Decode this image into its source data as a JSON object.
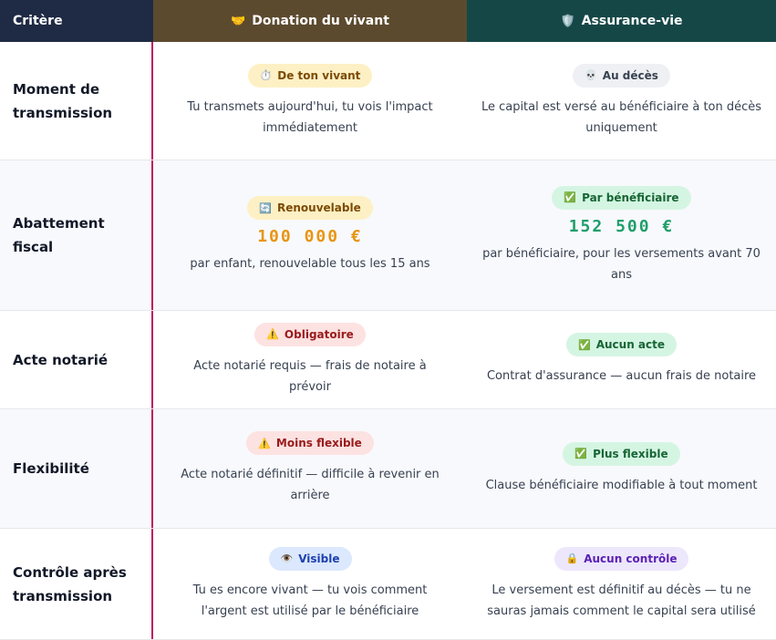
{
  "header": {
    "criteria": "Critère",
    "donation": {
      "icon": "🤝",
      "label": "Donation du vivant"
    },
    "assurance": {
      "icon": "🛡️",
      "label": "Assurance-vie"
    }
  },
  "rows": [
    {
      "criteria": "Moment de transmission",
      "donation": {
        "badge_icon": "⏱️",
        "badge": "De ton vivant",
        "desc": "Tu transmets aujourd'hui, tu vois l'impact immédiatement"
      },
      "assurance": {
        "badge_icon": "💀",
        "badge": "Au décès",
        "desc": "Le capital est versé au bénéficiaire à ton décès uniquement"
      }
    },
    {
      "criteria": "Abattement fiscal",
      "donation": {
        "badge_icon": "🔄",
        "badge": "Renouvelable",
        "amount": "100 000 €",
        "desc": "par enfant, renouvelable tous les 15 ans"
      },
      "assurance": {
        "badge_icon": "✅",
        "badge": "Par bénéficiaire",
        "amount": "152 500 €",
        "desc": "par bénéficiaire, pour les versements avant 70 ans"
      }
    },
    {
      "criteria": "Acte notarié",
      "donation": {
        "badge_icon": "⚠️",
        "badge": "Obligatoire",
        "desc": "Acte notarié requis — frais de notaire à prévoir"
      },
      "assurance": {
        "badge_icon": "✅",
        "badge": "Aucun acte",
        "desc": "Contrat d'assurance — aucun frais de notaire"
      }
    },
    {
      "criteria": "Flexibilité",
      "donation": {
        "badge_icon": "⚠️",
        "badge": "Moins flexible",
        "desc": "Acte notarié définitif — difficile à revenir en arrière"
      },
      "assurance": {
        "badge_icon": "✅",
        "badge": "Plus flexible",
        "desc": "Clause bénéficiaire modifiable à tout moment"
      }
    },
    {
      "criteria": "Contrôle après transmission",
      "donation": {
        "badge_icon": "👁️",
        "badge": "Visible",
        "desc": "Tu es encore vivant — tu vois comment l'argent est utilisé par le bénéficiaire"
      },
      "assurance": {
        "badge_icon": "🔒",
        "badge": "Aucun contrôle",
        "desc": "Le versement est définitif au décès — tu ne sauras jamais comment le capital sera utilisé"
      }
    }
  ]
}
